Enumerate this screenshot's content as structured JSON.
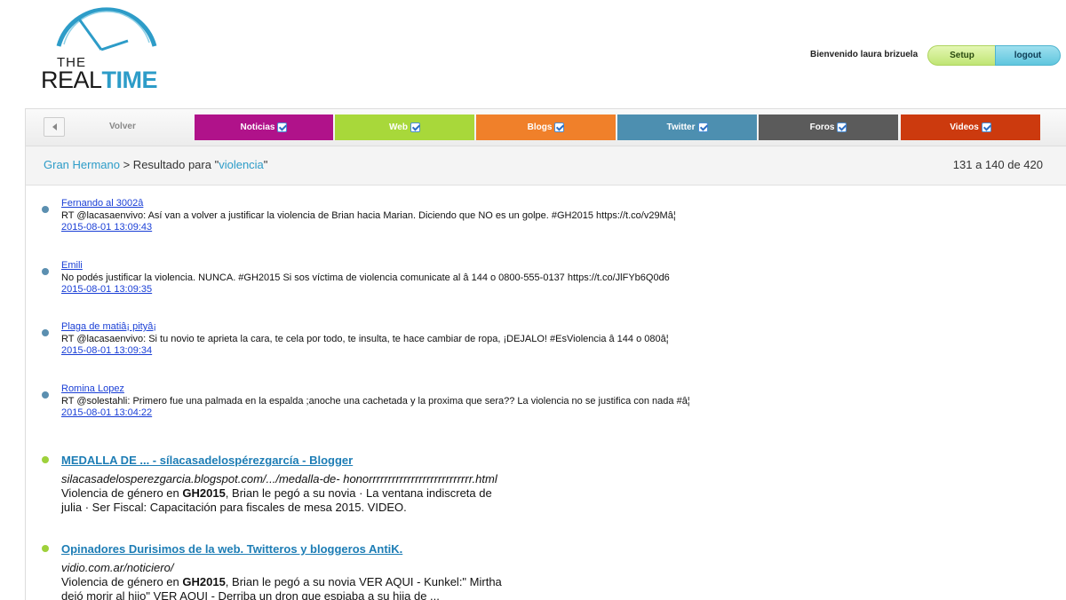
{
  "logo": {
    "the": "THE",
    "real": "REAL",
    "time": "TIME"
  },
  "user": {
    "welcome": "Bienvenido laura brizuela",
    "setup": "Setup",
    "logout": "logout"
  },
  "nav": {
    "volver": "Volver",
    "tabs": [
      {
        "label": "Noticias",
        "color": "#b0128a"
      },
      {
        "label": "Web",
        "color": "#a8d83a"
      },
      {
        "label": "Blogs",
        "color": "#f0802a"
      },
      {
        "label": "Twitter",
        "color": "#4d8fb0"
      },
      {
        "label": "Foros",
        "color": "#5b5b5b"
      },
      {
        "label": "Videos",
        "color": "#cc3a0e"
      }
    ]
  },
  "crumb": {
    "section": "Gran Hermano",
    "sep": " > Resultado para \"",
    "query": "violencia",
    "close": "\""
  },
  "count": "131 a 140 de 420",
  "tweets": [
    {
      "author": "Fernando al 3002â",
      "text": "RT @lacasaenvivo: Así van a volver a justificar la violencia de Brian hacia Marian. Diciendo que NO es un golpe. #GH2015 https://t.co/v29Mâ¦",
      "date": "2015-08-01 13:09:43"
    },
    {
      "author": "Emili ",
      "text": "No podés justificar la violencia. NUNCA. #GH2015 Si sos víctima de violencia comunicate al â 144 o 0800-555-0137 https://t.co/JlFYb6Q0d6",
      "date": "2015-08-01 13:09:35"
    },
    {
      "author": "Plaga de matiâ¡ pityâ¡",
      "text": "RT @lacasaenvivo: Si tu novio te aprieta la cara, te cela por todo, te insulta, te hace cambiar de ropa, ¡DEJALO! #EsViolencia â 144 o 080â¦",
      "date": "2015-08-01 13:09:34"
    },
    {
      "author": "Romina Lopez",
      "text": "RT @solestahli: Primero fue una palmada en la espalda ;anoche una cachetada y la proxima que sera?? La violencia no se justifica con nada #â¦",
      "date": "2015-08-01 13:04:22"
    }
  ],
  "blogs": [
    {
      "title": "MEDALLA DE ... - sílacasadelospérezgarcía - Blogger",
      "url": "silacasadelosperezgarcia.blogspot.com/.../medalla-de- honorrrrrrrrrrrrrrrrrrrrrrrrrrr.html",
      "snippet_a": "Violencia de género en ",
      "bold": "GH2015",
      "snippet_b": ", Brian le pegó a su novia · La ventana indiscreta de julia · Ser Fiscal: Capacitación para fiscales de mesa 2015. VIDEO."
    },
    {
      "title": "Opinadores Durisimos de la web. Twitteros y bloggeros AntiK.",
      "url": "vidio.com.ar/noticiero/",
      "snippet_a": "Violencia de género en ",
      "bold": "GH2015",
      "snippet_b": ", Brian le pegó a su novia VER AQUI - Kunkel:\" Mirtha dejó morir al hijo\" VER AQUI - Derriba un dron que espiaba a su hija de ..."
    }
  ]
}
